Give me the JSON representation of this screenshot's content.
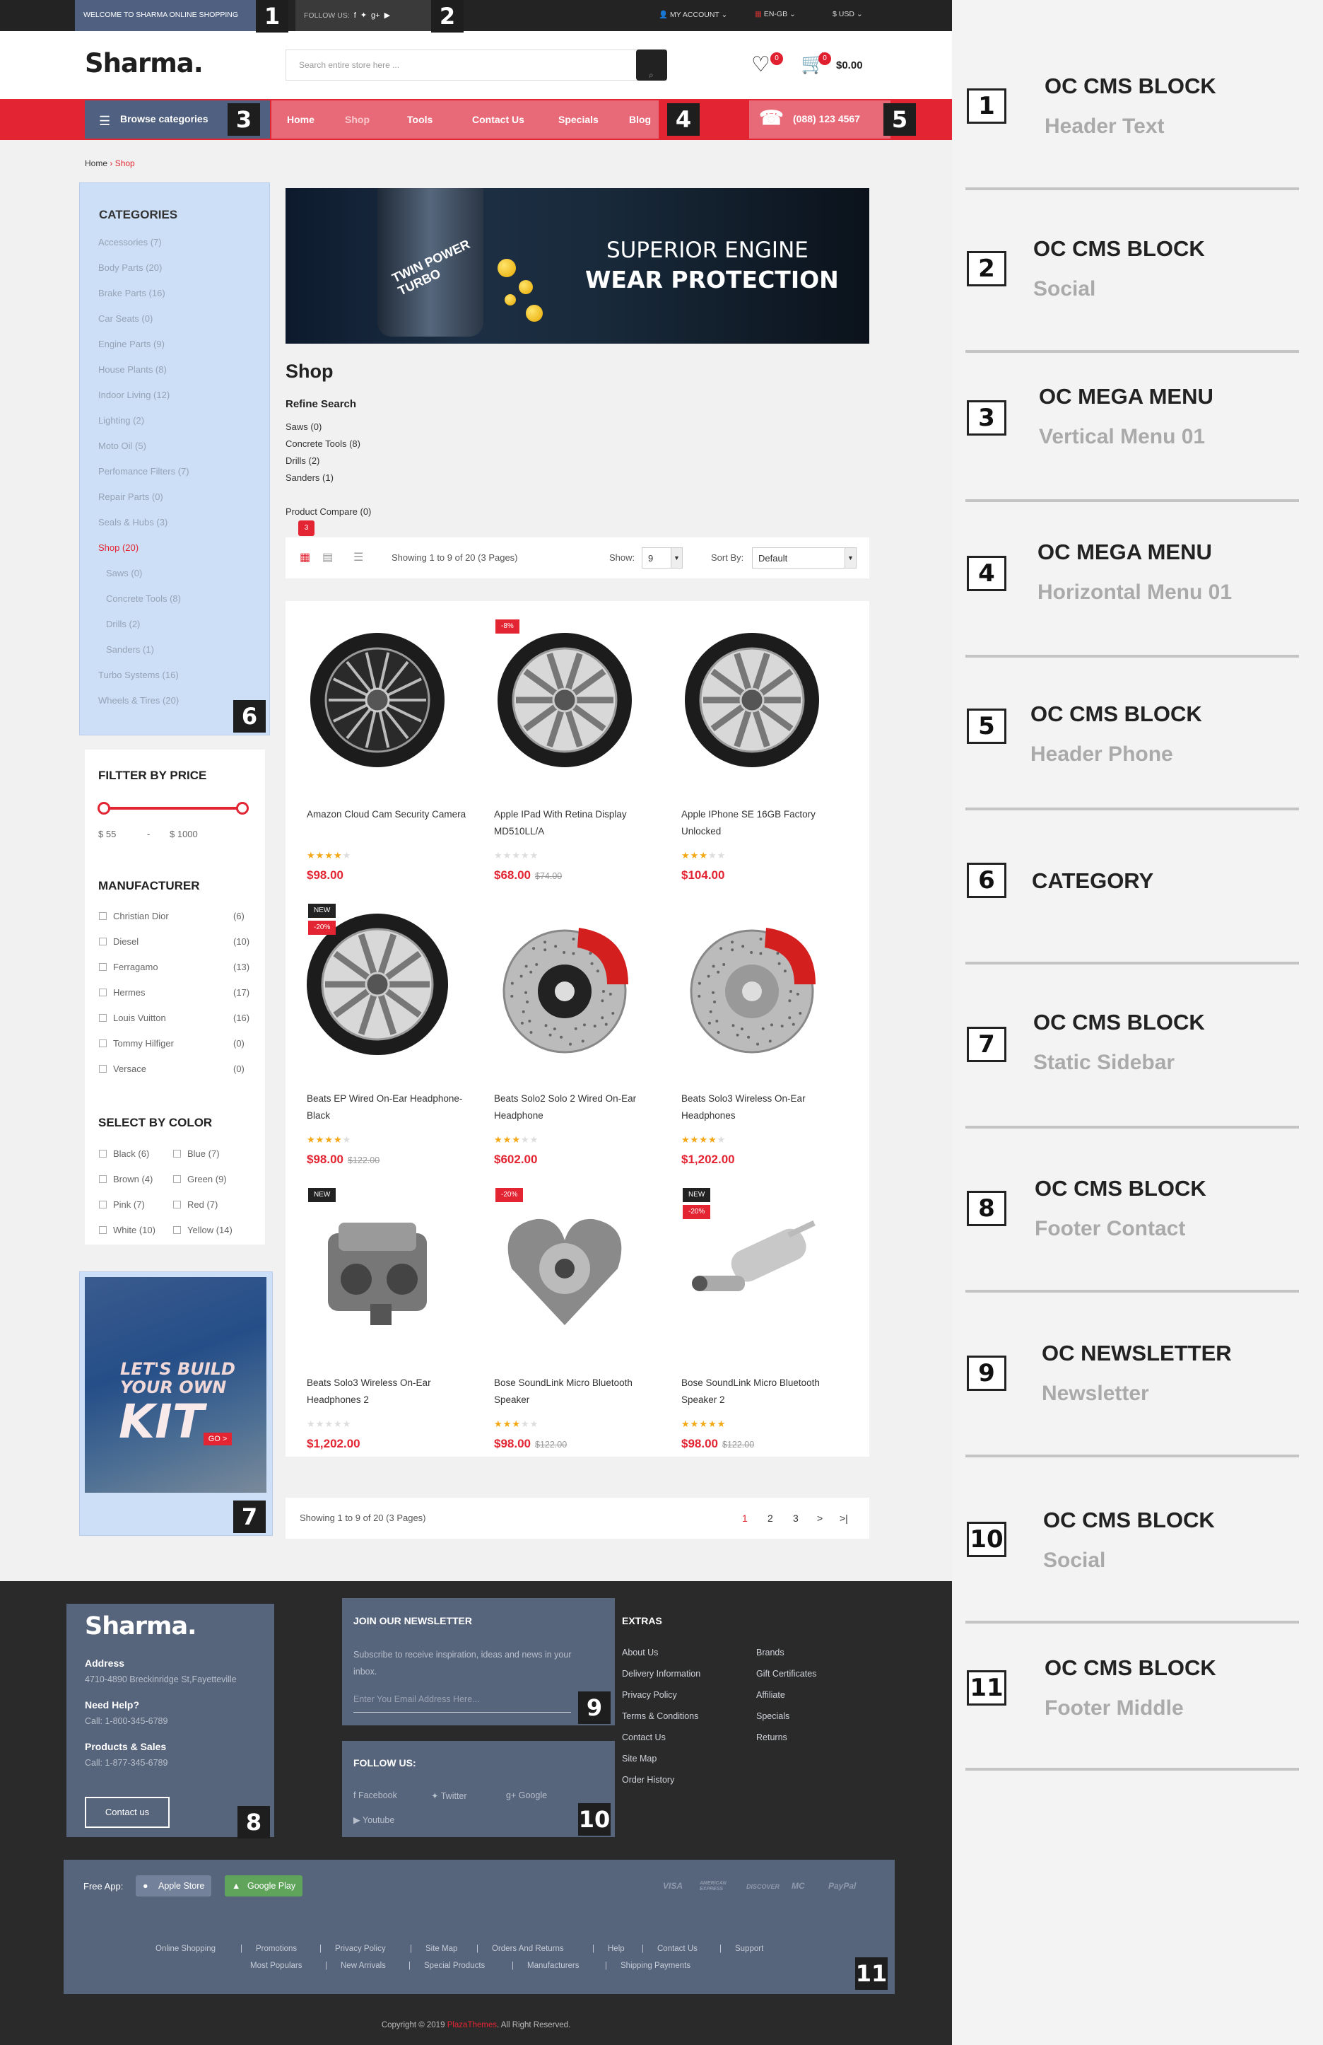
{
  "topbar": {
    "welcome": "WELCOME TO SHARMA ONLINE SHOPPING",
    "follow": "FOLLOW US:",
    "account": "MY ACCOUNT",
    "language": "EN-GB",
    "currency": "$ USD"
  },
  "header": {
    "logo": "Sharma.",
    "search_placeholder": "Search entire store here ...",
    "wishlist_count": "0",
    "cart_count": "0",
    "cart_total": "$0.00"
  },
  "nav": {
    "browse": "Browse categories",
    "items": [
      "Home",
      "Shop",
      "Tools",
      "Contact Us",
      "Specials",
      "Blog"
    ],
    "phone": "(088) 123 4567"
  },
  "breadcrumb": {
    "home": "Home",
    "current": "Shop"
  },
  "categories": {
    "title": "CATEGORIES",
    "items": [
      "Accessories (7)",
      "Body Parts (20)",
      "Brake Parts (16)",
      "Car Seats (0)",
      "Engine Parts (9)",
      "House Plants (8)",
      "Indoor Living (12)",
      "Lighting (2)",
      "Moto Oil (5)",
      "Perfomance Filters (7)",
      "Repair Parts (0)",
      "Seals & Hubs (3)",
      "Shop (20)",
      "Saws (0)",
      "Concrete Tools (8)",
      "Drills (2)",
      "Sanders (1)",
      "Turbo Systems (16)",
      "Wheels & Tires (20)"
    ]
  },
  "price_filter": {
    "title": "FILTTER BY PRICE",
    "min": "$ 55",
    "sep": "-",
    "max": "$ 1000"
  },
  "manufacturer": {
    "title": "MANUFACTURER",
    "items": [
      {
        "name": "Christian Dior",
        "count": "(6)"
      },
      {
        "name": "Diesel",
        "count": "(10)"
      },
      {
        "name": "Ferragamo",
        "count": "(13)"
      },
      {
        "name": "Hermes",
        "count": "(17)"
      },
      {
        "name": "Louis Vuitton",
        "count": "(16)"
      },
      {
        "name": "Tommy Hilfiger",
        "count": "(0)"
      },
      {
        "name": "Versace",
        "count": "(0)"
      }
    ]
  },
  "color": {
    "title": "SELECT BY COLOR",
    "items": [
      "Black (6)",
      "Blue (7)",
      "Brown (4)",
      "Green (9)",
      "Pink (7)",
      "Red (7)",
      "White (10)",
      "Yellow (14)"
    ]
  },
  "side_banner": {
    "line1": "LET'S BUILD",
    "line2": "YOUR OWN",
    "line3": "KIT",
    "go": "GO >"
  },
  "main_banner": {
    "line1": "SUPERIOR ENGINE",
    "line2": "WEAR PROTECTION",
    "bottle": "TWIN POWER TURBO"
  },
  "shop": {
    "title": "Shop",
    "refine": "Refine Search",
    "refine_links": [
      "Saws (0)",
      "Concrete Tools (8)",
      "Drills (2)",
      "Sanders (1)"
    ],
    "compare": "Product Compare (0)",
    "compare_badge": "3",
    "showing": "Showing 1 to 9 of 20 (3 Pages)",
    "show_label": "Show:",
    "show_value": "9",
    "sort_label": "Sort By:",
    "sort_value": "Default"
  },
  "products": [
    {
      "name": "Amazon Cloud Cam Security Camera",
      "rating": 4,
      "price": "$98.00",
      "old": "",
      "flags": []
    },
    {
      "name": "Apple IPad With Retina Display MD510LL/A",
      "rating": 0,
      "price": "$68.00",
      "old": "$74.00",
      "flags": [
        "-8%"
      ]
    },
    {
      "name": "Apple IPhone SE 16GB Factory Unlocked",
      "rating": 3,
      "price": "$104.00",
      "old": "",
      "flags": []
    },
    {
      "name": "Beats EP Wired On-Ear Headphone-Black",
      "rating": 4,
      "price": "$98.00",
      "old": "$122.00",
      "flags": [
        "NEW",
        "-20%"
      ]
    },
    {
      "name": "Beats Solo2 Solo 2 Wired On-Ear Headphone",
      "rating": 3,
      "price": "$602.00",
      "old": "",
      "flags": []
    },
    {
      "name": "Beats Solo3 Wireless On-Ear Headphones",
      "rating": 4,
      "price": "$1,202.00",
      "old": "",
      "flags": []
    },
    {
      "name": "Beats Solo3 Wireless On-Ear Headphones 2",
      "rating": 0,
      "price": "$1,202.00",
      "old": "",
      "flags": [
        "NEW"
      ]
    },
    {
      "name": "Bose SoundLink Micro Bluetooth Speaker",
      "rating": 3,
      "price": "$98.00",
      "old": "$122.00",
      "flags": [
        "-20%"
      ]
    },
    {
      "name": "Bose SoundLink Micro Bluetooth Speaker 2",
      "rating": 5,
      "price": "$98.00",
      "old": "$122.00",
      "flags": [
        "NEW",
        "-20%"
      ]
    }
  ],
  "pagination": {
    "showing": "Showing 1 to 9 of 20 (3 Pages)",
    "pages": [
      "1",
      "2",
      "3",
      ">",
      ">|"
    ]
  },
  "footer": {
    "logo": "Sharma.",
    "address_label": "Address",
    "address": "4710-4890 Breckinridge St,Fayetteville",
    "help_label": "Need Help?",
    "help_phone": "Call: 1-800-345-6789",
    "sales_label": "Products & Sales",
    "sales_phone": "Call: 1-877-345-6789",
    "contact_btn": "Contact us",
    "newsletter_title": "JOIN OUR NEWSLETTER",
    "newsletter_text": "Subscribe to receive inspiration, ideas and news in your inbox.",
    "newsletter_placeholder": "Enter You Email Address Here...",
    "follow_title": "FOLLOW US:",
    "social": [
      "Facebook",
      "Twitter",
      "Google",
      "Youtube"
    ],
    "extras_title": "EXTRAS",
    "extras_col1": [
      "About Us",
      "Delivery Information",
      "Privacy Policy",
      "Terms & Conditions",
      "Contact Us",
      "Site Map",
      "Order History"
    ],
    "extras_col2": [
      "Brands",
      "Gift Certificates",
      "Affiliate",
      "Specials",
      "Returns"
    ],
    "free_app": "Free App:",
    "apple": "Apple Store",
    "google": "Google Play",
    "payments": [
      "VISA",
      "AMERICAN EXPRESS",
      "DISCOVER",
      "MC",
      "PayPal"
    ],
    "links_row1": [
      "Online Shopping",
      "Promotions",
      "Privacy Policy",
      "Site Map",
      "Orders And Returns",
      "Help",
      "Contact Us",
      "Support"
    ],
    "links_row2": [
      "Most Populars",
      "New Arrivals",
      "Special Products",
      "Manufacturers",
      "Shipping Payments"
    ],
    "copyright_pre": "Copyright © 2019",
    "copyright_brand": "PlazaThemes",
    "copyright_post": ". All Right Reserved."
  },
  "tags": [
    "1",
    "2",
    "3",
    "4",
    "5",
    "6",
    "7",
    "8",
    "9",
    "10",
    "11"
  ],
  "legend": [
    {
      "num": "1",
      "title": "OC CMS BLOCK",
      "sub": "Header Text"
    },
    {
      "num": "2",
      "title": "OC CMS BLOCK",
      "sub": "Social"
    },
    {
      "num": "3",
      "title": "OC MEGA MENU",
      "sub": "Vertical Menu 01"
    },
    {
      "num": "4",
      "title": "OC MEGA MENU",
      "sub": "Horizontal Menu 01"
    },
    {
      "num": "5",
      "title": "OC CMS BLOCK",
      "sub": "Header Phone"
    },
    {
      "num": "6",
      "title": "CATEGORY",
      "sub": ""
    },
    {
      "num": "7",
      "title": "OC CMS BLOCK",
      "sub": "Static Sidebar"
    },
    {
      "num": "8",
      "title": "OC CMS BLOCK",
      "sub": "Footer Contact"
    },
    {
      "num": "9",
      "title": "OC NEWSLETTER",
      "sub": "Newsletter"
    },
    {
      "num": "10",
      "title": "OC CMS BLOCK",
      "sub": "Social"
    },
    {
      "num": "11",
      "title": "OC CMS BLOCK",
      "sub": "Footer Middle"
    }
  ]
}
